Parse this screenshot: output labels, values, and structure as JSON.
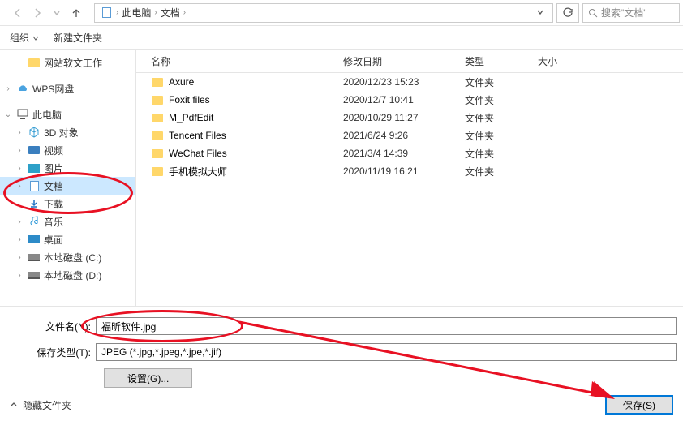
{
  "breadcrumb": {
    "root": "此电脑",
    "current": "文档"
  },
  "search": {
    "placeholder": "搜索\"文档\""
  },
  "toolbar": {
    "organize": "组织",
    "newfolder": "新建文件夹"
  },
  "sidebar": {
    "webwork": "网站软文工作",
    "wps": "WPS网盘",
    "thispc": "此电脑",
    "items": {
      "obj3d": "3D 对象",
      "video": "视频",
      "pictures": "图片",
      "documents": "文档",
      "downloads": "下载",
      "music": "音乐",
      "desktop": "桌面",
      "diskc": "本地磁盘 (C:)",
      "diskd": "本地磁盘 (D:)"
    }
  },
  "columns": {
    "name": "名称",
    "date": "修改日期",
    "type": "类型",
    "size": "大小"
  },
  "files": [
    {
      "name": "Axure",
      "date": "2020/12/23 15:23",
      "type": "文件夹"
    },
    {
      "name": "Foxit files",
      "date": "2020/12/7 10:41",
      "type": "文件夹"
    },
    {
      "name": "M_PdfEdit",
      "date": "2020/10/29 11:27",
      "type": "文件夹"
    },
    {
      "name": "Tencent Files",
      "date": "2021/6/24 9:26",
      "type": "文件夹"
    },
    {
      "name": "WeChat Files",
      "date": "2021/3/4 14:39",
      "type": "文件夹"
    },
    {
      "name": "手机模拟大师",
      "date": "2020/11/19 16:21",
      "type": "文件夹"
    }
  ],
  "filename": {
    "label": "文件名(N):",
    "value": "福昕软件.jpg"
  },
  "savetype": {
    "label": "保存类型(T):",
    "value": "JPEG (*.jpg,*.jpeg,*.jpe,*.jif)"
  },
  "settings_btn": "设置(G)...",
  "hide_folders": "隐藏文件夹",
  "save_btn": "保存(S)"
}
